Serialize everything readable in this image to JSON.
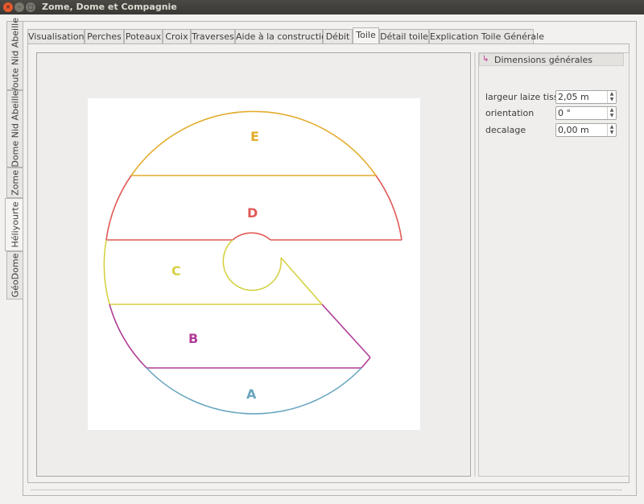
{
  "window": {
    "title": "Zome, Dome et Compagnie",
    "buttons": [
      "×",
      "–",
      "□"
    ]
  },
  "side_tabs": [
    {
      "label": "Voute Nid Abeille",
      "active": false
    },
    {
      "label": "Dome Nid Abeille",
      "active": false
    },
    {
      "label": "Zome",
      "active": false
    },
    {
      "label": "Héliyourte",
      "active": true
    },
    {
      "label": "GéoDome",
      "active": false
    }
  ],
  "tabs": [
    {
      "label": "Visualisation",
      "active": false
    },
    {
      "label": "Perches",
      "active": false
    },
    {
      "label": "Poteaux",
      "active": false
    },
    {
      "label": "Croix",
      "active": false
    },
    {
      "label": "Traverses",
      "active": false
    },
    {
      "label": "Aide à la construction",
      "active": false
    },
    {
      "label": "Débit",
      "active": false
    },
    {
      "label": "Toile",
      "active": true
    },
    {
      "label": "Détail toile",
      "active": false
    },
    {
      "label": "Explication Toile Générale",
      "active": false
    }
  ],
  "dock": {
    "title": "Dimensions générales",
    "icon": "layout-icon",
    "fields": [
      {
        "label": "largeur laize tissu",
        "value": "2,05 m"
      },
      {
        "label": "orientation",
        "value": "0 °"
      },
      {
        "label": "decalage",
        "value": "0,00 m"
      }
    ]
  },
  "drawing": {
    "sections": [
      {
        "label": "E",
        "color": "#e3ac2c"
      },
      {
        "label": "D",
        "color": "#e05a57"
      },
      {
        "label": "C",
        "color": "#d6d145"
      },
      {
        "label": "B",
        "color": "#b03c97"
      },
      {
        "label": "A",
        "color": "#6aa6c0"
      }
    ]
  }
}
